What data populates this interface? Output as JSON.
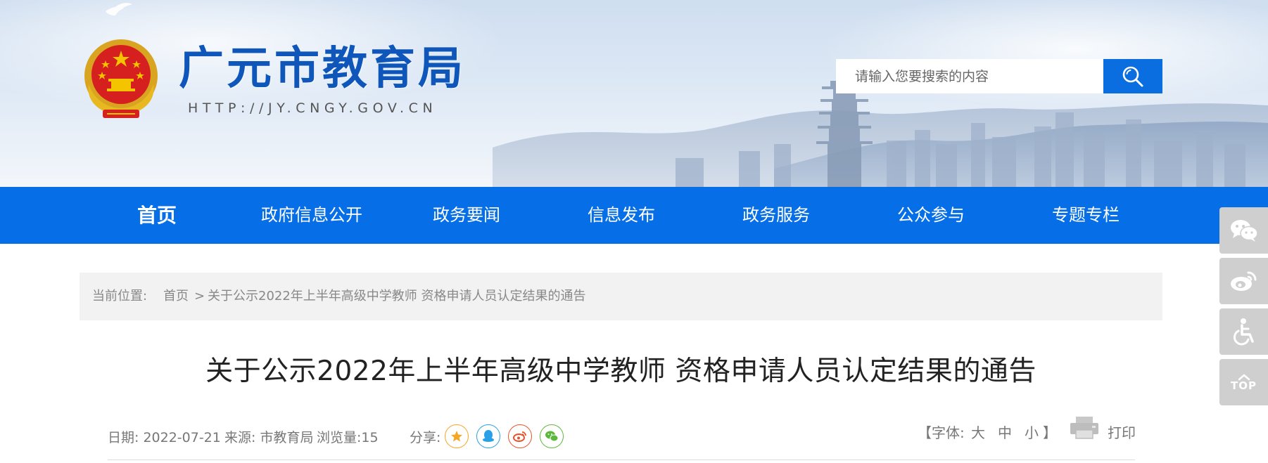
{
  "header": {
    "site_title": "广元市教育局",
    "site_url": "HTTP://JY.CNGY.GOV.CN",
    "search": {
      "placeholder": "请输入您要搜索的内容",
      "button_icon": "search-icon"
    }
  },
  "nav": {
    "items": [
      {
        "label": "首页"
      },
      {
        "label": "政府信息公开"
      },
      {
        "label": "政务要闻"
      },
      {
        "label": "信息发布"
      },
      {
        "label": "政务服务"
      },
      {
        "label": "公众参与"
      },
      {
        "label": "专题专栏"
      }
    ],
    "color": "#066ee6"
  },
  "breadcrumb": {
    "label": "当前位置:",
    "home": "首页",
    "separator": ">",
    "current": "关于公示2022年上半年高级中学教师 资格申请人员认定结果的通告"
  },
  "article": {
    "title": "关于公示2022年上半年高级中学教师 资格申请人员认定结果的通告",
    "date": "日期: 2022-07-21",
    "source": "来源: 市教育局",
    "views": "浏览量:15",
    "share_label": "分享:",
    "share_icons": [
      "qzone-icon",
      "qq-icon",
      "weibo-icon",
      "wechat-icon"
    ],
    "font_controls": {
      "open": "【字体:",
      "large": "大",
      "medium": "中",
      "small": "小",
      "close": "】"
    },
    "print_label": "打印"
  },
  "side_toolbar": {
    "items": [
      "wechat-icon",
      "weibo-icon",
      "accessibility-icon",
      "back-to-top-icon"
    ],
    "top_label": "TOP"
  }
}
